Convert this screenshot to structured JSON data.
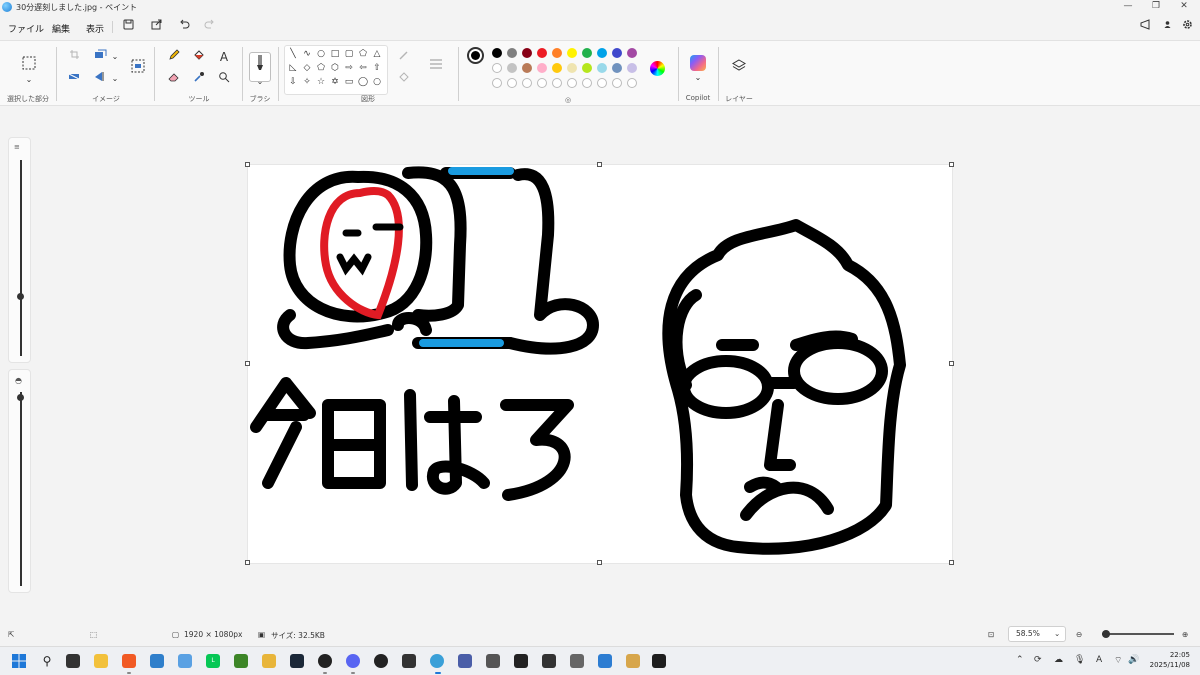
{
  "window": {
    "title": "30分遅刻しました.jpg - ペイント",
    "minimize_glyph": "—",
    "restore_glyph": "❐",
    "close_glyph": "✕"
  },
  "menu": {
    "file": "ファイル",
    "edit": "編集",
    "view": "表示"
  },
  "ribbon": {
    "groups": {
      "selection": "選択した部分",
      "image": "イメージ",
      "tools": "ツール",
      "brush": "ブラシ",
      "shapes": "図形",
      "copilot": "Copilot",
      "layers": "レイヤー"
    },
    "tools_text_glyph": "A",
    "palette": {
      "primary": "#000000",
      "secondary": "#000000",
      "row1": [
        "#000000",
        "#7f7f7f",
        "#880015",
        "#ed1c24",
        "#ff7f27",
        "#fff200",
        "#22b14c",
        "#00a2e8",
        "#3f48cc",
        "#a349a4"
      ],
      "row2": [
        "#ffffff",
        "#c3c3c3",
        "#b97a57",
        "#ffaec9",
        "#ffc90e",
        "#efe4b0",
        "#b5e61d",
        "#99d9ea",
        "#7092be",
        "#c8bfe7"
      ]
    }
  },
  "status": {
    "dimensions": "1920 × 1080px",
    "filesize": "サイズ: 32.5KB",
    "zoom": "58.5%",
    "zoom_level": 0.05
  },
  "taskbar": {
    "time": "22:05",
    "date": "2025/11/08",
    "ime": "A"
  },
  "drawing": {
    "text": "今日は3",
    "colors": {
      "ink": "#000000",
      "red": "#e01b24",
      "blue": "#1a9be0"
    }
  }
}
